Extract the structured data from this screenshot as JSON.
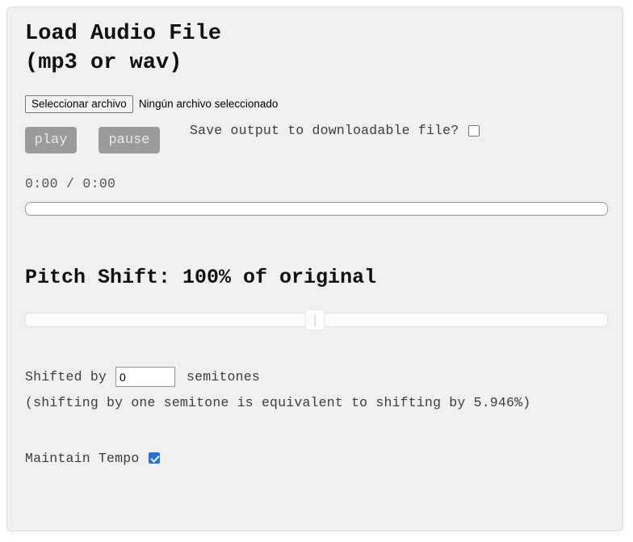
{
  "app": {
    "title": "Load Audio File\n(mp3 or wav)"
  },
  "file_input": {
    "button_label": "Seleccionar archivo",
    "status_text": "Ningún archivo seleccionado"
  },
  "transport": {
    "play_label": "play",
    "pause_label": "pause",
    "time_display": "0:00 / 0:00",
    "progress_value": 0
  },
  "save_output": {
    "label": "Save output to downloadable file?",
    "checked": false
  },
  "pitch": {
    "heading": "Pitch Shift: 100% of original",
    "percent": "100%",
    "slider_value": 50,
    "slider_min": 0,
    "slider_max": 100
  },
  "semitones": {
    "prefix_label": "Shifted by",
    "value": "0",
    "suffix_label": "semitones",
    "note": "(shifting by one semitone is equivalent to shifting by 5.946%)"
  },
  "tempo": {
    "label": "Maintain Tempo",
    "checked": true
  },
  "colors": {
    "accent": "#1a73e8",
    "button_gray": "#9b9b9b",
    "page_bg": "#f0f0f0"
  }
}
